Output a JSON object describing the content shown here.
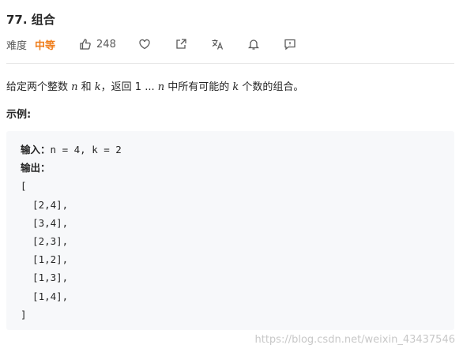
{
  "problem": {
    "title": "77. 组合",
    "difficulty_label": "难度",
    "difficulty": "中等",
    "likes": "248"
  },
  "description": {
    "part1": "给定两个整数 ",
    "n1": "n",
    "part2": " 和 ",
    "k1": "k",
    "part3": "，返回 1 ... ",
    "n2": "n",
    "part4": " 中所有可能的 ",
    "k2": "k",
    "part5": " 个数的组合。"
  },
  "example": {
    "label": "示例:",
    "input_label": "输入：",
    "input_value": "n = 4, k = 2",
    "output_label": "输出：",
    "output_lines": "[\n  [2,4],\n  [3,4],\n  [2,3],\n  [1,2],\n  [1,3],\n  [1,4],\n]"
  },
  "footer": {
    "watermark": "https://blog.csdn.net/weixin_43437546"
  },
  "icons": {
    "like": "thumbs-up-icon",
    "favorite": "heart-icon",
    "share": "share-icon",
    "translate": "translate-icon",
    "notify": "bell-icon",
    "feedback": "feedback-icon"
  },
  "colors": {
    "difficulty_medium": "#ef7d1a",
    "example_bg": "#f7f8fa"
  }
}
